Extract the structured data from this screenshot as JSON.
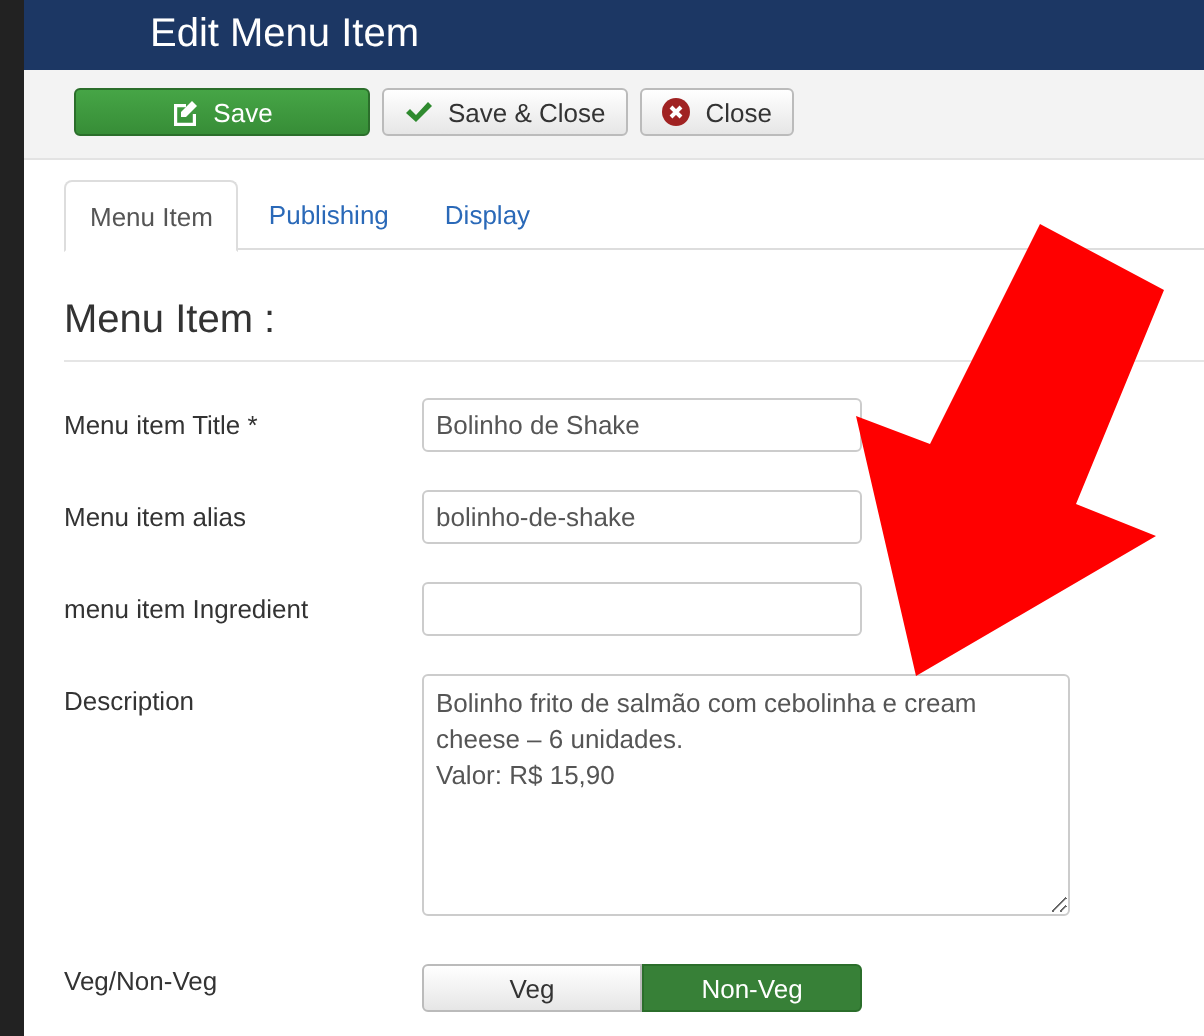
{
  "window": {
    "title": "Edit Menu Item"
  },
  "toolbar": [
    {
      "kind": "save",
      "label": "Save"
    },
    {
      "kind": "save-close",
      "label": "Save & Close"
    },
    {
      "kind": "close",
      "label": "Close"
    }
  ],
  "tabs": [
    {
      "label": "Menu Item",
      "selected": true
    },
    {
      "label": "Publishing",
      "selected": false
    },
    {
      "label": "Display",
      "selected": false
    }
  ],
  "section": {
    "title": "Menu Item :"
  },
  "fields": [
    {
      "kind": "text",
      "label": "Menu item Title *",
      "value": "Bolinho de Shake"
    },
    {
      "kind": "text",
      "label": "Menu item alias",
      "value": "bolinho-de-shake"
    },
    {
      "kind": "text",
      "label": "menu item Ingredient"
    },
    {
      "kind": "textarea",
      "label": "Description",
      "value": "Bolinho frito de salmão com cebolinha e cream cheese – 6 unidades.\nValor: R$ 15,90"
    },
    {
      "kind": "toggle",
      "label": "Veg/Non-Veg",
      "options": [
        {
          "label": "Veg",
          "selected": false
        },
        {
          "label": "Non-Veg",
          "selected": true
        }
      ]
    }
  ]
}
